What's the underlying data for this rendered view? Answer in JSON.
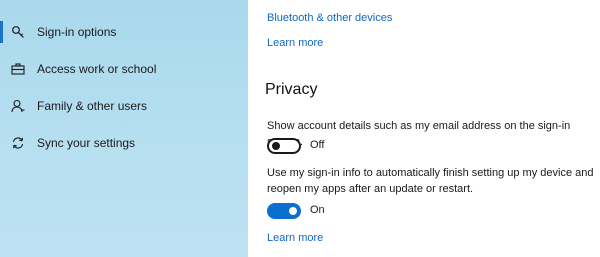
{
  "sidebar": {
    "items": [
      {
        "label": "Sign-in options",
        "icon": "key-icon",
        "selected": true
      },
      {
        "label": "Access work or school",
        "icon": "briefcase-icon",
        "selected": false
      },
      {
        "label": "Family & other users",
        "icon": "person-icon",
        "selected": false
      },
      {
        "label": "Sync your settings",
        "icon": "sync-icon",
        "selected": false
      }
    ]
  },
  "main": {
    "bluetooth_link": "Bluetooth & other devices",
    "learn_more_top": "Learn more",
    "privacy_heading": "Privacy",
    "setting1": {
      "description": "Show account details such as my email address on the sign-in screen.",
      "state": "Off"
    },
    "setting2": {
      "description_line1": "Use my sign-in info to automatically finish setting up my device and",
      "description_line2": "reopen my apps after an update or restart.",
      "state": "On"
    },
    "learn_more_bottom": "Learn more"
  },
  "colors": {
    "accent": "#0a6fce",
    "link": "#1267c4",
    "sidebar_bg": "#b4def0"
  }
}
